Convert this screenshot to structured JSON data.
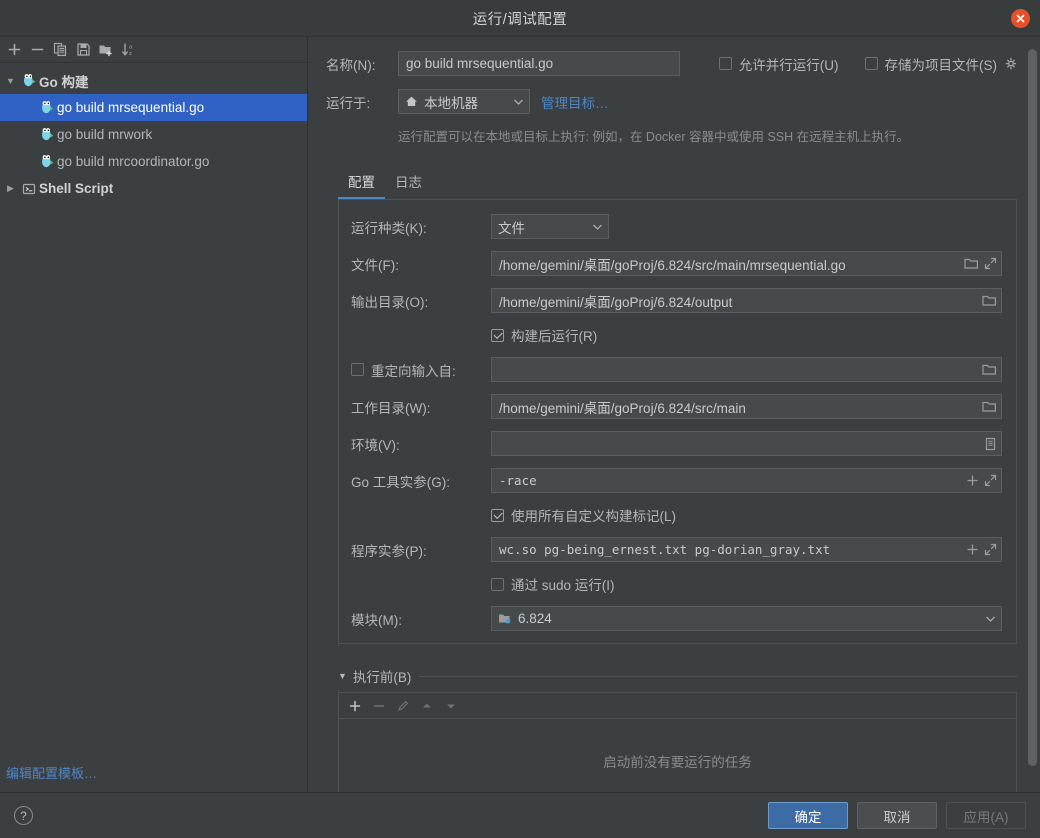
{
  "window": {
    "title": "运行/调试配置",
    "close_icon": "close-icon",
    "close_color": "#e8502b"
  },
  "sidebar": {
    "toolbar": [
      {
        "name": "add-configuration-button",
        "icon": "plus-icon"
      },
      {
        "name": "remove-configuration-button",
        "icon": "minus-icon"
      },
      {
        "name": "copy-configuration-button",
        "icon": "copy-icon"
      },
      {
        "name": "save-configuration-button",
        "icon": "save-icon"
      },
      {
        "name": "move-into-folder-button",
        "icon": "folder-add-icon"
      },
      {
        "name": "sort-configurations-button",
        "icon": "sort-alphabetical-icon"
      }
    ],
    "tree": [
      {
        "label": "Go 构建",
        "type": "group",
        "expanded": true,
        "twisty": "▼",
        "icon": "go-gopher-icon",
        "selected": false
      },
      {
        "label": "go build mrsequential.go",
        "type": "child",
        "icon": "go-gopher-icon",
        "selected": true
      },
      {
        "label": "go build mrwork",
        "type": "child",
        "icon": "go-gopher-icon",
        "selected": false
      },
      {
        "label": "go build mrcoordinator.go",
        "type": "child",
        "icon": "go-gopher-icon",
        "selected": false
      },
      {
        "label": "Shell Script",
        "type": "group",
        "expanded": false,
        "twisty": "▶",
        "icon": "shell-script-icon",
        "selected": false
      }
    ],
    "edit_templates_link": "编辑配置模板…"
  },
  "header": {
    "name_label": "名称(N):",
    "name_value": "go build mrsequential.go",
    "allow_parallel_label": "允许并行运行(U)",
    "allow_parallel_checked": false,
    "store_as_project_label": "存储为项目文件(S)",
    "store_as_project_checked": false,
    "gear_icon": "gear-icon",
    "run_on_label": "运行于:",
    "run_on_value": "本地机器",
    "run_on_icon": "home-icon",
    "manage_targets_link": "管理目标…",
    "hint": "运行配置可以在本地或目标上执行: 例如，在 Docker 容器中或使用 SSH 在远程主机上执行。",
    "link_color": "#4e86c7"
  },
  "tabs": [
    {
      "label": "配置",
      "active": true
    },
    {
      "label": "日志",
      "active": false
    }
  ],
  "form": {
    "run_kind": {
      "label": "运行种类(K):",
      "value": "文件"
    },
    "file": {
      "label": "文件(F):",
      "value": "/home/gemini/桌面/goProj/6.824/src/main/mrsequential.go",
      "icons": [
        "folder-icon",
        "expand-icon"
      ]
    },
    "output_dir": {
      "label": "输出目录(O):",
      "value": "/home/gemini/桌面/goProj/6.824/output",
      "icons": [
        "folder-icon"
      ]
    },
    "run_after_build": {
      "label": "构建后运行(R)",
      "checked": true
    },
    "redirect_input": {
      "label": "重定向输入自:",
      "checked": false,
      "value": "",
      "icons": [
        "folder-icon"
      ]
    },
    "working_dir": {
      "label": "工作目录(W):",
      "value": "/home/gemini/桌面/goProj/6.824/src/main",
      "icons": [
        "folder-icon"
      ]
    },
    "environment": {
      "label": "环境(V):",
      "value": "",
      "icons": [
        "list-icon"
      ]
    },
    "go_tool_args": {
      "label": "Go 工具实参(G):",
      "value": "-race",
      "icons": [
        "insert-macro-icon",
        "expand-icon"
      ]
    },
    "use_all_custom_build_tags": {
      "label": "使用所有自定义构建标记(L)",
      "checked": true
    },
    "program_args": {
      "label": "程序实参(P):",
      "value": "wc.so pg-being_ernest.txt pg-dorian_gray.txt",
      "icons": [
        "insert-macro-icon",
        "expand-icon"
      ]
    },
    "run_with_sudo": {
      "label": "通过 sudo 运行(I)",
      "checked": false
    },
    "module": {
      "label": "模块(M):",
      "value": "6.824",
      "icon": "module-icon"
    }
  },
  "before_launch": {
    "title": "执行前(B)",
    "expanded": true,
    "toolbar": [
      {
        "name": "add-task-button",
        "icon": "plus-icon",
        "enabled": true
      },
      {
        "name": "remove-task-button",
        "icon": "minus-icon",
        "enabled": false
      },
      {
        "name": "edit-task-button",
        "icon": "pencil-icon",
        "enabled": false
      },
      {
        "name": "move-task-up-button",
        "icon": "arrow-up-icon",
        "enabled": false
      },
      {
        "name": "move-task-down-button",
        "icon": "arrow-down-icon",
        "enabled": false
      }
    ],
    "empty_text": "启动前没有要运行的任务"
  },
  "footer": {
    "help_label": "?",
    "ok_label": "确定",
    "cancel_label": "取消",
    "apply_label": "应用(A)",
    "apply_enabled": false,
    "primary_color": "#3c6ba5"
  }
}
